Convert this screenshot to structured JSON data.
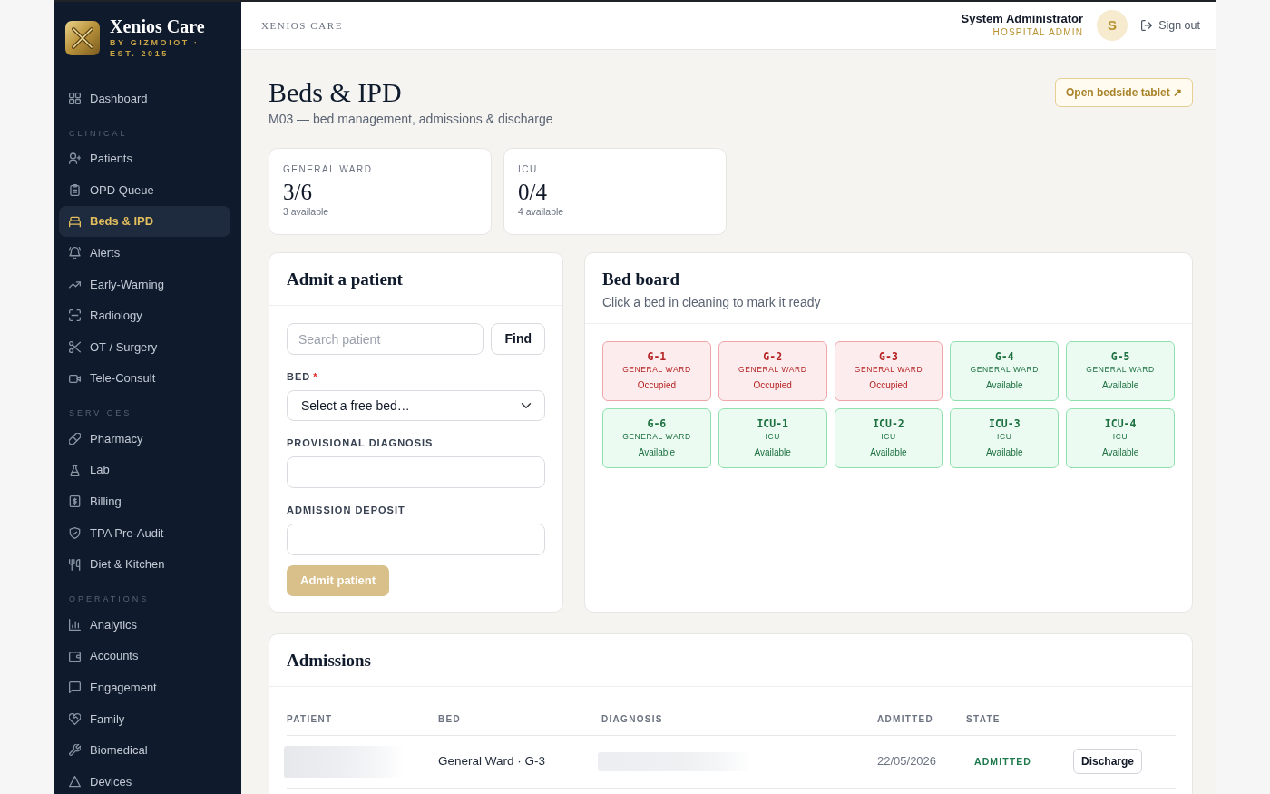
{
  "sidebar": {
    "brand": {
      "name": "Xenios Care",
      "tagline": "BY GIZMOIOT · EST. 2015"
    },
    "sections": [
      {
        "items": [
          {
            "label": "Dashboard",
            "selected": false
          }
        ]
      },
      {
        "title": "CLINICAL",
        "items": [
          {
            "label": "Patients",
            "selected": false
          },
          {
            "label": "OPD Queue",
            "selected": false
          },
          {
            "label": "Beds & IPD",
            "selected": true
          },
          {
            "label": "Alerts",
            "selected": false
          },
          {
            "label": "Early-Warning",
            "selected": false
          },
          {
            "label": "Radiology",
            "selected": false
          },
          {
            "label": "OT / Surgery",
            "selected": false
          },
          {
            "label": "Tele-Consult",
            "selected": false
          }
        ]
      },
      {
        "title": "SERVICES",
        "items": [
          {
            "label": "Pharmacy",
            "selected": false
          },
          {
            "label": "Lab",
            "selected": false
          },
          {
            "label": "Billing",
            "selected": false
          },
          {
            "label": "TPA Pre-Audit",
            "selected": false
          },
          {
            "label": "Diet & Kitchen",
            "selected": false
          }
        ]
      },
      {
        "title": "OPERATIONS",
        "items": [
          {
            "label": "Analytics",
            "selected": false
          },
          {
            "label": "Accounts",
            "selected": false
          },
          {
            "label": "Engagement",
            "selected": false
          },
          {
            "label": "Family",
            "selected": false
          },
          {
            "label": "Biomedical",
            "selected": false
          },
          {
            "label": "Devices",
            "selected": false
          }
        ]
      }
    ]
  },
  "top_bar": {
    "brand_label": "XENIOS CARE",
    "user": {
      "name": "System Administrator",
      "role": "HOSPITAL ADMIN",
      "initial": "S"
    },
    "sign_out": "Sign out"
  },
  "page": {
    "title": "Beds & IPD",
    "subtitle": "M03 — bed management, admissions & discharge",
    "action": "Open bedside tablet ↗"
  },
  "ward_stats": [
    {
      "label": "GENERAL WARD",
      "value": "3/6",
      "note": "3 available"
    },
    {
      "label": "ICU",
      "value": "0/4",
      "note": "4 available"
    }
  ],
  "admit_form": {
    "title": "Admit a patient",
    "search": {
      "placeholder": "Search patient"
    },
    "find_button": "Find",
    "fields": [
      {
        "label": "BED",
        "required_mark": "*",
        "kind": "select",
        "value": "Select a free bed…"
      },
      {
        "label": "PROVISIONAL DIAGNOSIS",
        "kind": "text"
      },
      {
        "label": "ADMISSION DEPOSIT",
        "kind": "text"
      }
    ],
    "submit": {
      "label": "Admit patient",
      "disabled": true
    }
  },
  "bed_board": {
    "title": "Bed board",
    "subtitle": "Click a bed in cleaning to mark it ready",
    "beds": [
      {
        "id": "G-1",
        "ward": "GENERAL WARD",
        "status": "Occupied",
        "kind": "occupied"
      },
      {
        "id": "G-2",
        "ward": "GENERAL WARD",
        "status": "Occupied",
        "kind": "occupied"
      },
      {
        "id": "G-3",
        "ward": "GENERAL WARD",
        "status": "Occupied",
        "kind": "occupied"
      },
      {
        "id": "G-4",
        "ward": "GENERAL WARD",
        "status": "Available",
        "kind": "available"
      },
      {
        "id": "G-5",
        "ward": "GENERAL WARD",
        "status": "Available",
        "kind": "available"
      },
      {
        "id": "G-6",
        "ward": "GENERAL WARD",
        "status": "Available",
        "kind": "available"
      },
      {
        "id": "ICU-1",
        "ward": "ICU",
        "status": "Available",
        "kind": "available"
      },
      {
        "id": "ICU-2",
        "ward": "ICU",
        "status": "Available",
        "kind": "available"
      },
      {
        "id": "ICU-3",
        "ward": "ICU",
        "status": "Available",
        "kind": "available"
      },
      {
        "id": "ICU-4",
        "ward": "ICU",
        "status": "Available",
        "kind": "available"
      }
    ]
  },
  "admissions": {
    "title": "Admissions",
    "columns": [
      "PATIENT",
      "BED",
      "DIAGNOSIS",
      "ADMITTED",
      "STATE"
    ],
    "rows": [
      {
        "patient": {
          "redacted": true
        },
        "bed": "General Ward · G-3",
        "diagnosis": {
          "redacted": true
        },
        "admitted": "22/05/2026",
        "state": "ADMITTED",
        "action": "Discharge"
      }
    ]
  }
}
